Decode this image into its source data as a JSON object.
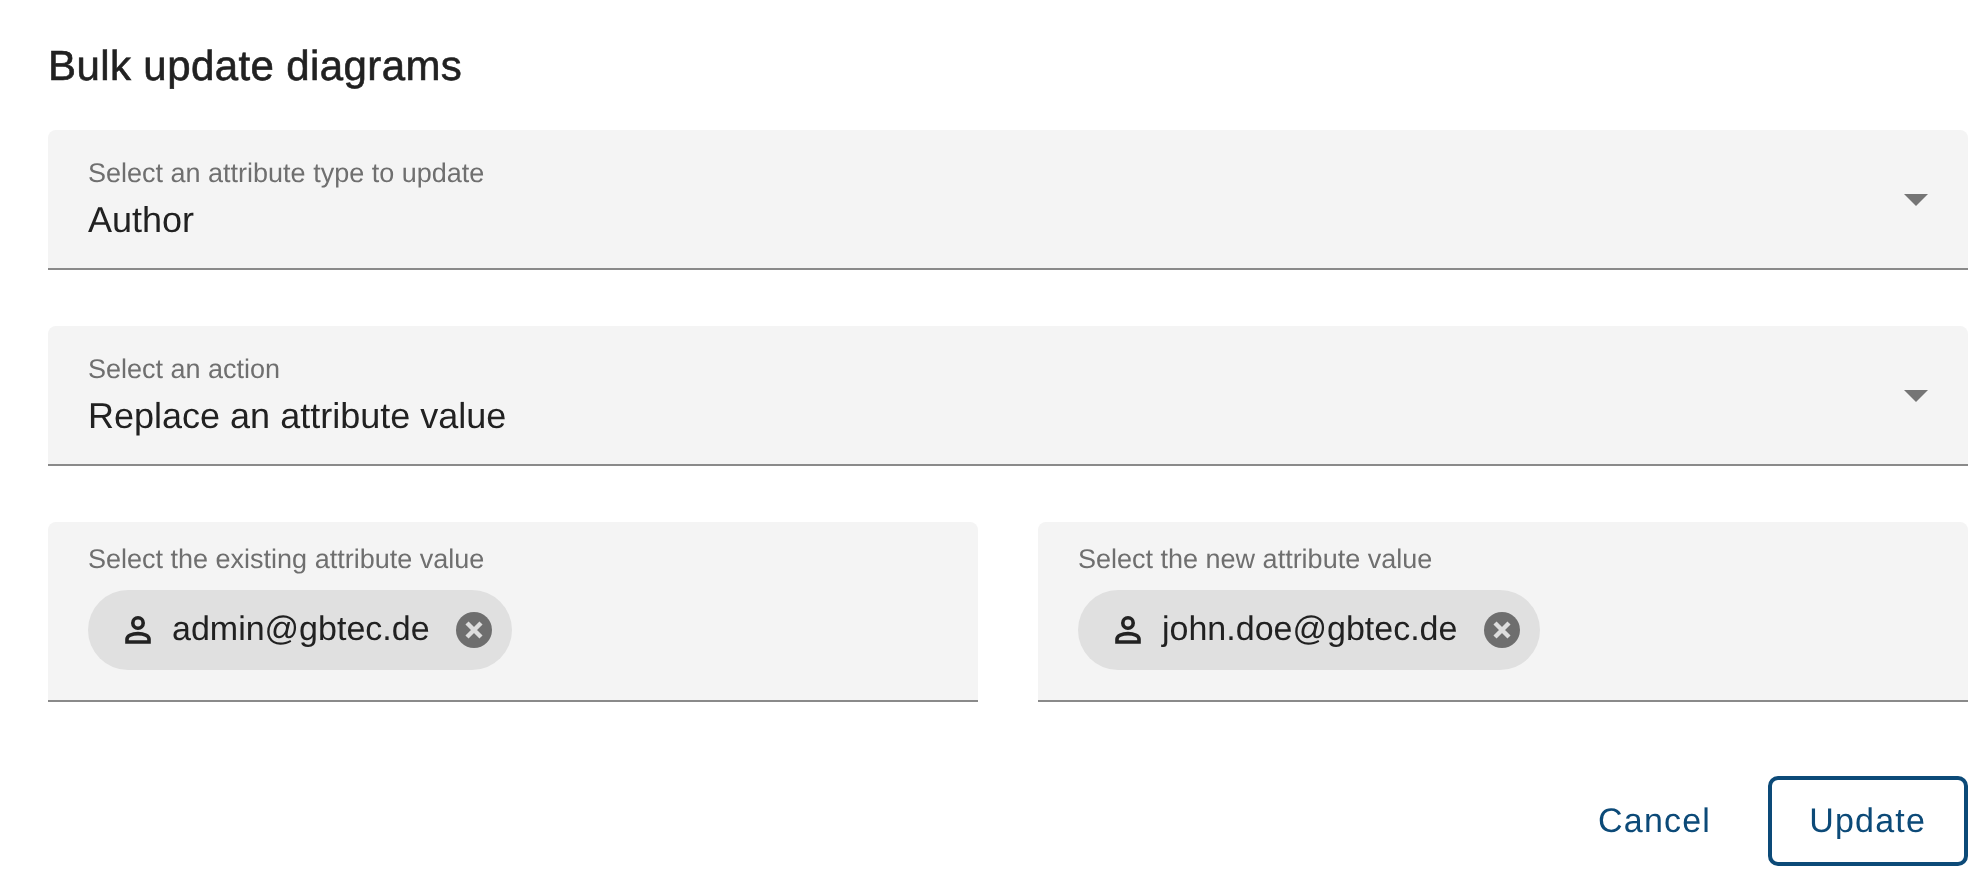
{
  "dialog": {
    "title": "Bulk update diagrams"
  },
  "selects": [
    {
      "label": "Select an attribute type to update",
      "value": "Author"
    },
    {
      "label": "Select an action",
      "value": "Replace an attribute value"
    }
  ],
  "chip_fields": [
    {
      "label": "Select the existing attribute value",
      "chips": [
        {
          "text": "admin@gbtec.de"
        }
      ]
    },
    {
      "label": "Select the new attribute value",
      "chips": [
        {
          "text": "john.doe@gbtec.de"
        }
      ]
    }
  ],
  "buttons": [
    {
      "label": "Cancel",
      "kind": "text"
    },
    {
      "label": "Update",
      "kind": "outlined"
    }
  ]
}
